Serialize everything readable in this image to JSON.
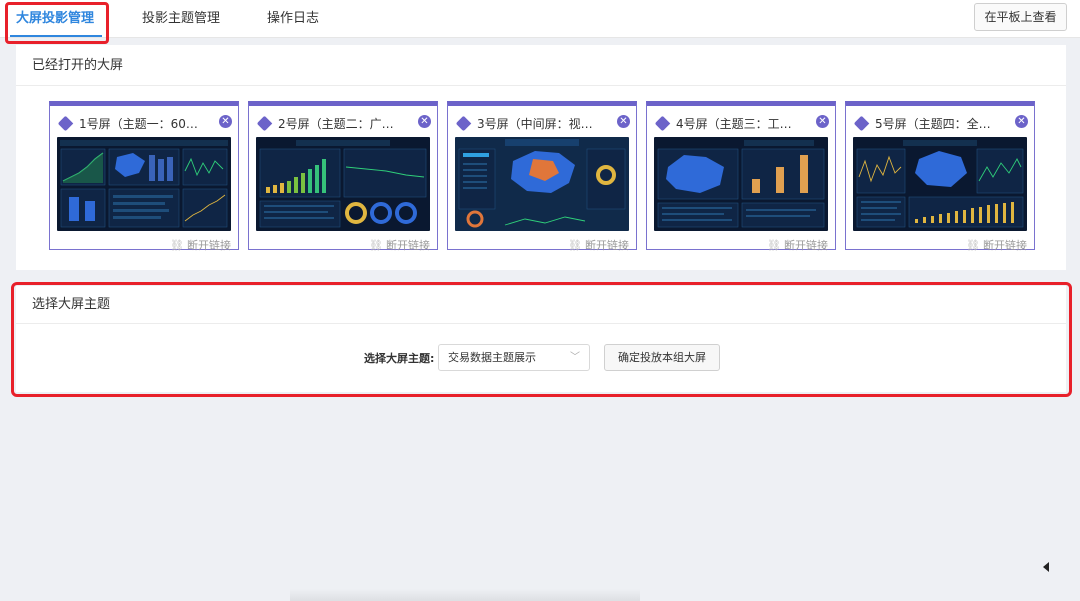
{
  "tabs": [
    {
      "label": "大屏投影管理",
      "active": true
    },
    {
      "label": "投影主题管理",
      "active": false
    },
    {
      "label": "操作日志",
      "active": false
    }
  ],
  "tablet_button": "在平板上查看",
  "opened_panel": {
    "title": "已经打开的大屏",
    "screens": [
      {
        "label": "1号屏（主题一：60…",
        "disconnect": "断开链接",
        "close_icon": "close-icon"
      },
      {
        "label": "2号屏（主题二：广…",
        "disconnect": "断开链接",
        "close_icon": "close-icon"
      },
      {
        "label": "3号屏（中间屏：视…",
        "disconnect": "断开链接",
        "close_icon": "close-icon"
      },
      {
        "label": "4号屏（主题三：工…",
        "disconnect": "断开链接",
        "close_icon": "close-icon"
      },
      {
        "label": "5号屏（主题四：全…",
        "disconnect": "断开链接",
        "close_icon": "close-icon"
      }
    ]
  },
  "theme_panel": {
    "title": "选择大屏主题",
    "select_label": "选择大屏主题:",
    "select_value": "交易数据主题展示",
    "confirm_button": "确定投放本组大屏"
  },
  "colors": {
    "accent": "#2f86de",
    "card_border": "#6c63c9",
    "highlight_red": "#e8202a",
    "page_bg": "#eef0f4"
  }
}
